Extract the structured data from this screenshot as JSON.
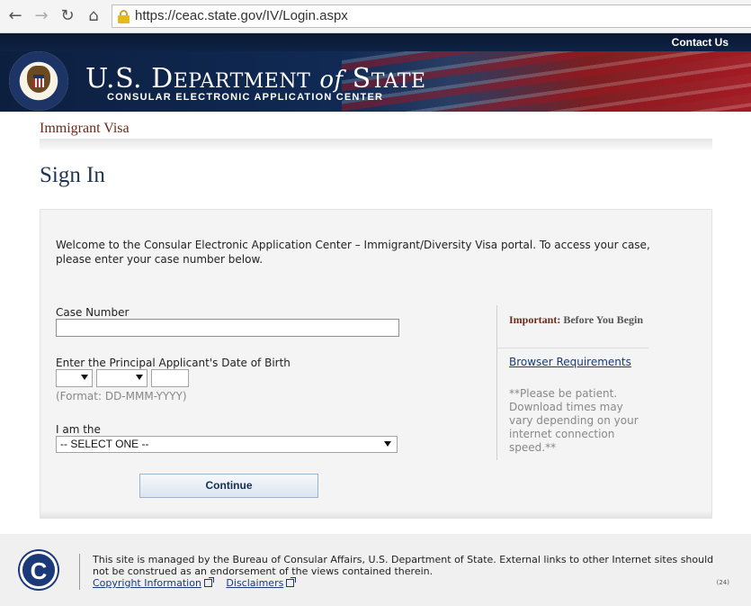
{
  "browser": {
    "back_icon": "←",
    "forward_icon": "→",
    "reload_icon": "↻",
    "home_icon": "⌂",
    "url": "https://ceac.state.gov/IV/Login.aspx"
  },
  "header": {
    "contact_label": "Contact Us",
    "dept_us": "U.S. D",
    "dept_epartment": "EPARTMENT",
    "dept_of": "of",
    "dept_s": "S",
    "dept_tate": "TATE",
    "subtitle": "CONSULAR ELECTRONIC APPLICATION CENTER"
  },
  "page": {
    "program": "Immigrant Visa",
    "title": "Sign In"
  },
  "form": {
    "welcome": "Welcome to the Consular Electronic Application Center – Immigrant/Diversity Visa portal. To access your case, please enter your case number below.",
    "case_label": "Case Number",
    "case_value": "",
    "dob_label": "Enter the Principal Applicant's Date of Birth",
    "dob_format": "(Format: DD-MMM-YYYY)",
    "role_label": "I am the",
    "role_selected": "-- SELECT ONE --",
    "continue_label": "Continue"
  },
  "side": {
    "important_label": "Important:",
    "important_text": "Before You Begin",
    "browser_link": "Browser Requirements",
    "patience": "**Please be patient. Download times may vary depending on your internet connection speed.**"
  },
  "footer": {
    "logo_letter": "C",
    "text": "This site is managed by the Bureau of Consular Affairs, U.S. Department of State. External links to other Internet sites should not be construed as an endorsement of the views contained therein.",
    "copyright_link": "Copyright Information",
    "disclaimers_link": "Disclaimers",
    "version": "(24)"
  }
}
